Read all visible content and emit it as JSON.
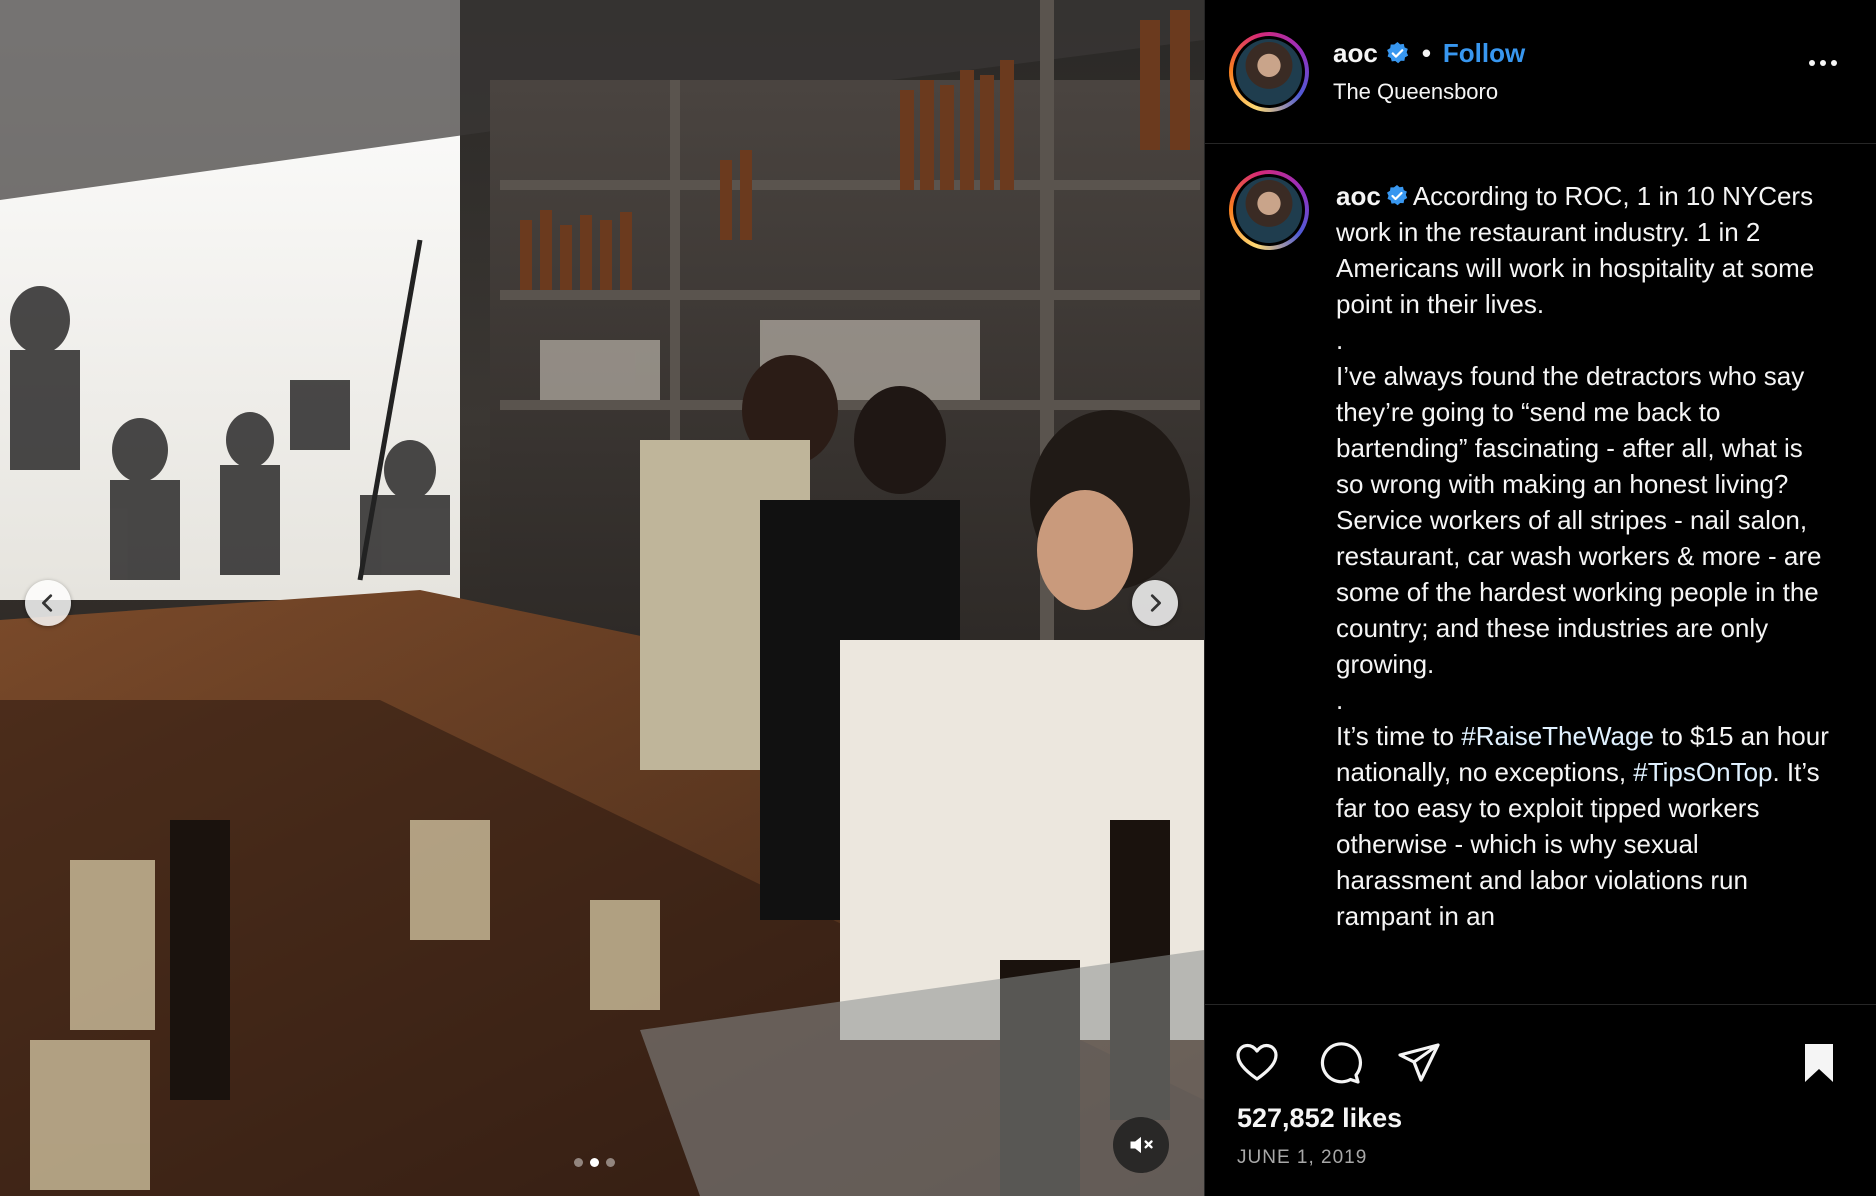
{
  "post": {
    "username": "aoc",
    "separator": "•",
    "follow_label": "Follow",
    "location": "The Queensboro",
    "likes": "527,852 likes",
    "date": "JUNE 1, 2019"
  },
  "caption": {
    "p1": "According to ROC, 1 in 10 NYCers work in the restaurant industry. 1 in 2 Americans will work in hospitality at some point in their lives.",
    "dot1": ".",
    "p2": "I’ve always found the detractors who say they’re going to “send me back to bartending” fascinating - after all, what is so wrong with making an honest living? Service workers of all stripes - nail salon, restaurant, car wash workers & more - are some of the hardest working people in the country; and these industries are only growing.",
    "dot2": ".",
    "p3_a": "It’s time to ",
    "hashtag1": "#RaiseTheWage",
    "p3_b": " to $15 an hour nationally, no exceptions, ",
    "hashtag2": "#TipsOnTop",
    "p3_c": ". It’s far too easy to exploit tipped workers otherwise - which is why sexual harassment and labor violations run rampant in an"
  },
  "carousel": {
    "slides": 3,
    "active_index": 1
  },
  "icons": {
    "verified": "verified-badge-icon",
    "prev": "chevron-left-icon",
    "next": "chevron-right-icon",
    "mute": "speaker-muted-icon",
    "like": "heart-icon",
    "comment": "comment-icon",
    "share": "paper-plane-icon",
    "save": "bookmark-icon",
    "more": "more-horizontal-icon"
  },
  "colors": {
    "background": "#000000",
    "link_blue": "#3897f0",
    "verified_blue": "#3897f0",
    "text_primary": "#f5f5f5",
    "text_secondary": "#a8a8a8"
  }
}
